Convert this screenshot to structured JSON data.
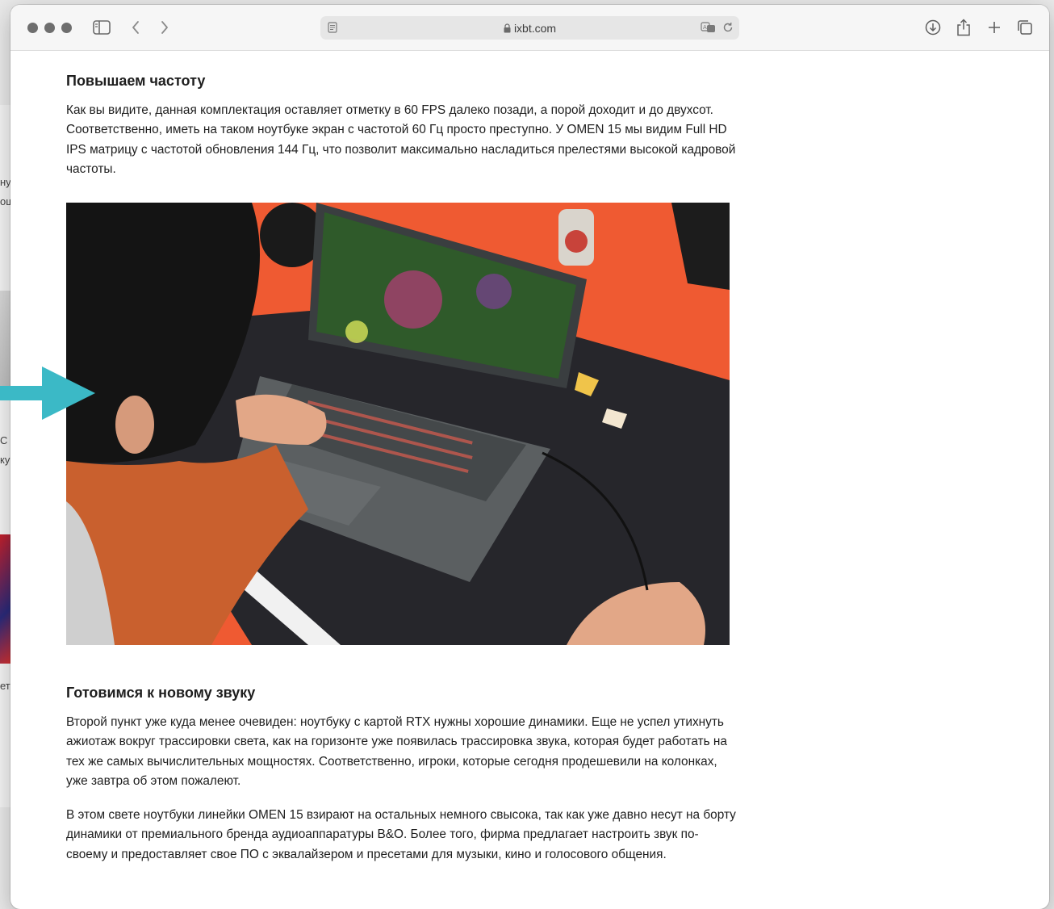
{
  "browser": {
    "url": "ixbt.com"
  },
  "background_window": {
    "fragments": [
      "ну",
      "ощ",
      "С",
      "ку",
      "ет"
    ]
  },
  "article": {
    "sections": [
      {
        "heading": "Повышаем частоту",
        "paragraphs": [
          "Как вы видите, данная комплектация оставляет отметку в 60 FPS далеко позади, а порой доходит и до двухсот. Соответственно, иметь на таком ноутбуке экран с частотой 60 Гц просто преступно. У OMEN 15 мы видим Full HD IPS матрицу с частотой обновления 144 Гц, что позволит максимально насладиться прелестями высокой кадровой частоты."
        ]
      },
      {
        "heading": "Готовимся к новому звуку",
        "paragraphs": [
          "Второй пункт уже куда менее очевиден: ноутбуку с картой RTX нужны хорошие динамики. Еще не успел утихнуть ажиотаж вокруг трассировки света, как на горизонте уже появилась трассировка звука, которая будет работать на тех же самых вычислительных мощностях. Соответственно, игроки, которые сегодня продешевили на колонках, уже завтра об этом пожалеют.",
          "В этом свете ноутбуки линейки OMEN 15 взирают на остальных немного свысока, так как уже давно несут на борту динамики от премиального бренда аудиоаппаратуры B&O. Более того, фирма предлагает настроить звук по-своему и предоставляет свое ПО с эквалайзером и пресетами для музыки, кино и голосового общения."
        ]
      }
    ]
  },
  "colors": {
    "arrow": "#3bb9c6",
    "desk_orange": "#ef5a32",
    "mat_dark": "#26262b"
  }
}
